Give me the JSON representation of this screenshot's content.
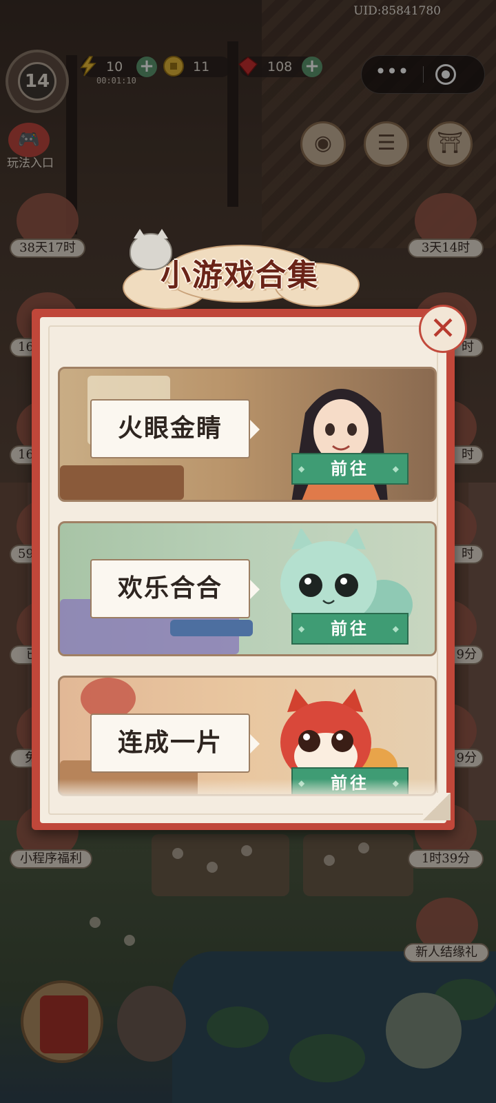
{
  "uid": "UID:85841780",
  "level": "14",
  "resources": {
    "energy": "10",
    "energy_timer": "00:01:10",
    "coins": "11",
    "gems": "108"
  },
  "play_entry_label": "玩法入口",
  "side_left": [
    "38天17时",
    "16时",
    "16时",
    "59分",
    "已",
    "免",
    "小程序福利"
  ],
  "side_right": [
    "3天14时",
    "时",
    "时",
    "时",
    "9分",
    "9分",
    "1时39分",
    "新人结缘礼"
  ],
  "modal": {
    "title": "小游戏合集",
    "games": [
      {
        "name": "火眼金睛",
        "button": "前往"
      },
      {
        "name": "欢乐合合",
        "button": "前往"
      },
      {
        "name": "连成一片",
        "button": "前往"
      }
    ]
  },
  "icons": {
    "energy": "lightning-icon",
    "coin": "coin-icon",
    "gem": "gem-icon",
    "close": "close-icon",
    "eye": "eye-icon",
    "list": "list-icon",
    "shop": "shop-icon"
  },
  "colors": {
    "modal_frame": "#c0473a",
    "paper": "#f4ece0",
    "go_button": "#3f9c74",
    "title": "#6a2418"
  }
}
